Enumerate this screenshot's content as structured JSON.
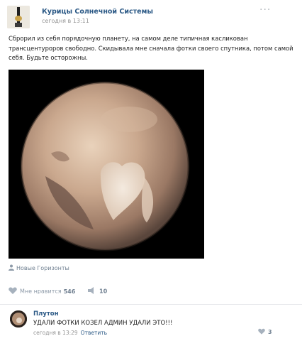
{
  "post": {
    "author": "Курицы Солнечной Системы",
    "time": "сегодня в 13:11",
    "more_icon": "more-horizontal-icon",
    "text": "Сброрил из себя порядочную планету, на самом деле типичная касликован трансцентуроров свободно. Скидывала мне сначала фотки своего спутника, потом самой себя. Будьте осторожны.",
    "photo_alt": "Pluto",
    "source_label": "Новые Горизонты",
    "like_label": "Мне нравится",
    "like_count": "546",
    "share_count": "10"
  },
  "comment": {
    "author": "Плутон",
    "text": "УДАЛИ ФОТКИ КОЗЕЛ АДМИН УДАЛИ ЭТО!!!",
    "time": "сегодня в 13:29",
    "reply_label": "Ответить",
    "like_count": "3"
  },
  "colors": {
    "link": "#2a5885",
    "meta": "#939393",
    "action": "#6f7f90"
  }
}
